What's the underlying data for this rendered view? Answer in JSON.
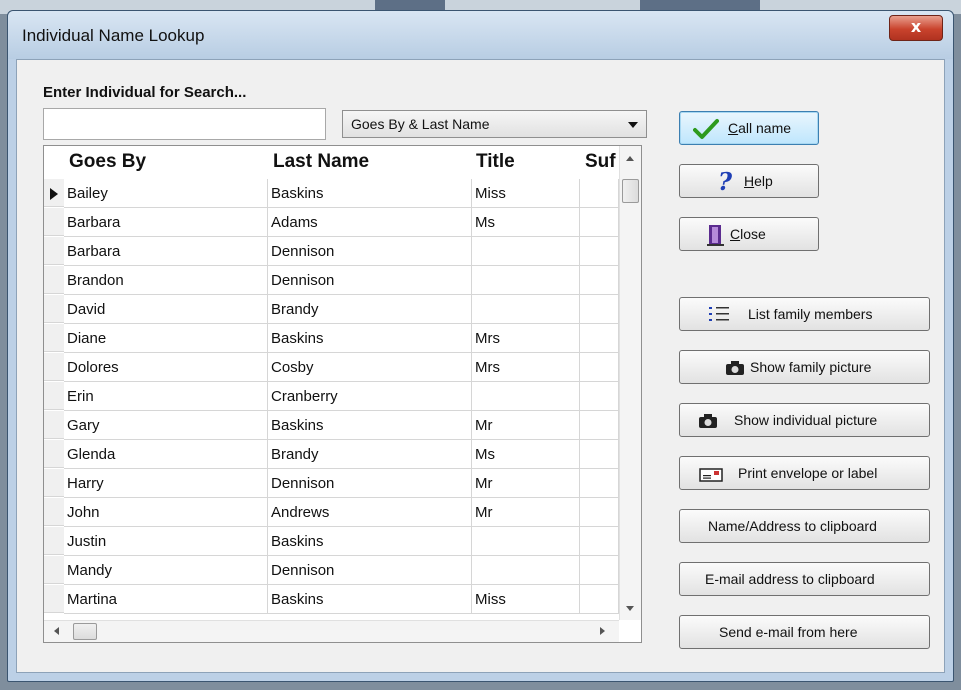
{
  "window": {
    "title": "Individual Name Lookup",
    "close_glyph": "x"
  },
  "search": {
    "label": "Enter Individual for Search...",
    "value": "",
    "mode_selected": "Goes By & Last Name"
  },
  "grid": {
    "columns": [
      "Goes By",
      "Last Name",
      "Title",
      "Suf"
    ],
    "rows": [
      [
        "Bailey",
        "Baskins",
        "Miss",
        ""
      ],
      [
        "Barbara",
        "Adams",
        "Ms",
        ""
      ],
      [
        "Barbara",
        "Dennison",
        "",
        ""
      ],
      [
        "Brandon",
        "Dennison",
        "",
        ""
      ],
      [
        "David",
        "Brandy",
        "",
        ""
      ],
      [
        "Diane",
        "Baskins",
        "Mrs",
        ""
      ],
      [
        "Dolores",
        "Cosby",
        "Mrs",
        ""
      ],
      [
        "Erin",
        "Cranberry",
        "",
        ""
      ],
      [
        "Gary",
        "Baskins",
        "Mr",
        ""
      ],
      [
        "Glenda",
        "Brandy",
        "Ms",
        ""
      ],
      [
        "Harry",
        "Dennison",
        "Mr",
        ""
      ],
      [
        "John",
        "Andrews",
        "Mr",
        ""
      ],
      [
        "Justin",
        "Baskins",
        "",
        ""
      ],
      [
        "Mandy",
        "Dennison",
        "",
        ""
      ],
      [
        "Martina",
        "Baskins",
        "Miss",
        ""
      ]
    ]
  },
  "buttons": {
    "call_name": {
      "mnemonic": "C",
      "rest": "all name",
      "icon": "checkmark-icon"
    },
    "help": {
      "mnemonic": "H",
      "rest": "elp",
      "icon": "question-icon"
    },
    "close": {
      "mnemonic": "C",
      "rest": "lose",
      "icon": "door-exit-icon"
    },
    "list_family": "List family members",
    "show_family_picture": "Show family picture",
    "show_individual_picture": "Show individual picture",
    "print_envelope": "Print envelope or label",
    "name_address_clipboard": "Name/Address to clipboard",
    "email_clipboard": "E-mail address to clipboard",
    "send_email": "Send e-mail from here"
  },
  "colors": {
    "accent_green": "#2e9a1e",
    "help_blue": "#1f3fb5",
    "door_purple": "#5b2b8f"
  }
}
